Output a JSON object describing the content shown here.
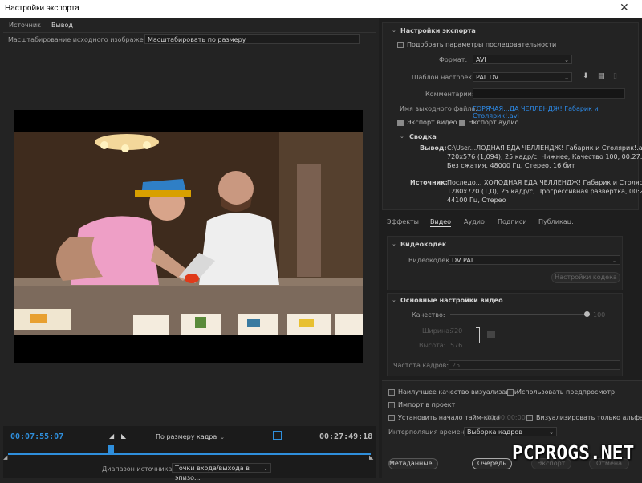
{
  "window": {
    "title": "Настройки экспорта",
    "close": "✕"
  },
  "left": {
    "tabs": [
      {
        "label": "Источник"
      },
      {
        "label": "Вывод"
      }
    ],
    "scaling": {
      "label": "Масштабирование исходного изображения:",
      "value": "Масштабировать по размеру"
    },
    "timeline": {
      "current_tc": "00:07:55:07",
      "end_tc": "00:27:49:18",
      "fit": "По размеру кадра",
      "range_label": "Диапазон источника:",
      "range_value": "Точки входа/выхода в эпизо..."
    }
  },
  "export": {
    "header": "Настройки экспорта",
    "match_sequence": "Подобрать параметры последовательности",
    "format_label": "Формат:",
    "format_value": "AVI",
    "preset_label": "Шаблон настроек:",
    "preset_value": "PAL DV",
    "comment_label": "Комментарии:",
    "comment_value": "",
    "output_label": "Имя выходного файла:",
    "output_value": "ГОРЯЧАЯ...ДА ЧЕЛЛЕНДЖ! Габарик и Столярик!.avi",
    "export_video": "Экспорт видео",
    "export_audio": "Экспорт аудио"
  },
  "summary": {
    "header": "Сводка",
    "output_label": "Вывод:",
    "output_lines": [
      "C:\\User...ЛОДНАЯ ЕДА ЧЕЛЛЕНДЖ! Габарик и Столярик!.avi",
      "720x576 (1,094), 25 кадр/с, Нижнее, Качество 100, 00:27:4...",
      "Без сжатия, 48000 Гц, Стерео, 16 бит"
    ],
    "source_label": "Источник:",
    "source_lines": [
      "Последо... ХОЛОДНАЯ ЕДА ЧЕЛЛЕНДЖ! Габарик и Столярик!",
      "1280x720 (1,0), 25 кадр/с, Прогрессивная развертка, 00:27...",
      "44100 Гц, Стерео"
    ]
  },
  "tabs2": [
    {
      "label": "Эффекты"
    },
    {
      "label": "Видео"
    },
    {
      "label": "Аудио"
    },
    {
      "label": "Подписи"
    },
    {
      "label": "Публикац."
    }
  ],
  "video_codec": {
    "header": "Видеокодек",
    "label": "Видеокодек:",
    "value": "DV PAL",
    "settings_button": "Настройки кодека"
  },
  "basic_video": {
    "header": "Основные настройки видео",
    "quality_label": "Качество:",
    "quality_value": "100",
    "quality": 1.0,
    "width_label": "Ширина:",
    "width_value": "720",
    "height_label": "Высота:",
    "height_value": "576",
    "fps_label": "Частота кадров:",
    "fps_value": "25"
  },
  "bottom": {
    "max_quality": "Наилучшее качество визуализации",
    "use_previews": "Использовать предпросмотр",
    "import_project": "Импорт в проект",
    "set_start_tc": "Установить начало тайм-кода",
    "start_tc_value": "00:00:00:00",
    "alpha_only": "Визуализировать только альфа-кан",
    "interp_label": "Интерполяция времени:",
    "interp_value": "Выборка кадров",
    "metadata": "Метаданные...",
    "queue": "Очередь",
    "export": "Экспорт",
    "cancel": "Отмена"
  },
  "watermark": {
    "text": "PCPROGS.NET"
  },
  "colors": {
    "accent": "#2d8ceb",
    "timecode": "#2f8fdc",
    "panel": "#232323"
  }
}
